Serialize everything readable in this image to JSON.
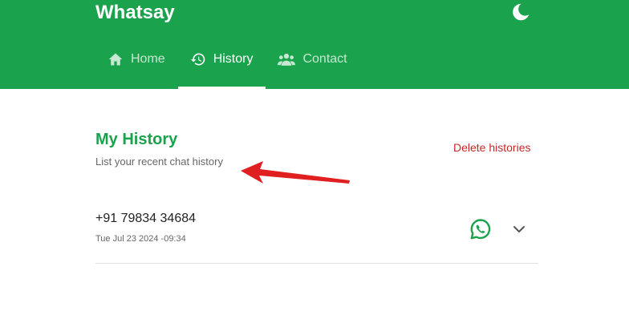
{
  "app": {
    "title": "Whatsay"
  },
  "colors": {
    "brand": "#1aa24c",
    "danger": "#c62828",
    "annotation_arrow": "#e02020"
  },
  "icons": {
    "theme": "moon-icon",
    "home": "home-icon",
    "history": "history-icon",
    "contact": "contacts-icon",
    "whatsapp": "whatsapp-icon",
    "expand": "chevron-down-icon"
  },
  "nav": {
    "tabs": [
      {
        "label": "Home",
        "active": false
      },
      {
        "label": "History",
        "active": true
      },
      {
        "label": "Contact",
        "active": false
      }
    ]
  },
  "main": {
    "title": "My History",
    "subtitle": "List your recent chat history",
    "delete_label": "Delete histories"
  },
  "history": {
    "items": [
      {
        "phone": "+91 79834 34684",
        "timestamp": "Tue Jul 23 2024 -09:34"
      }
    ]
  }
}
